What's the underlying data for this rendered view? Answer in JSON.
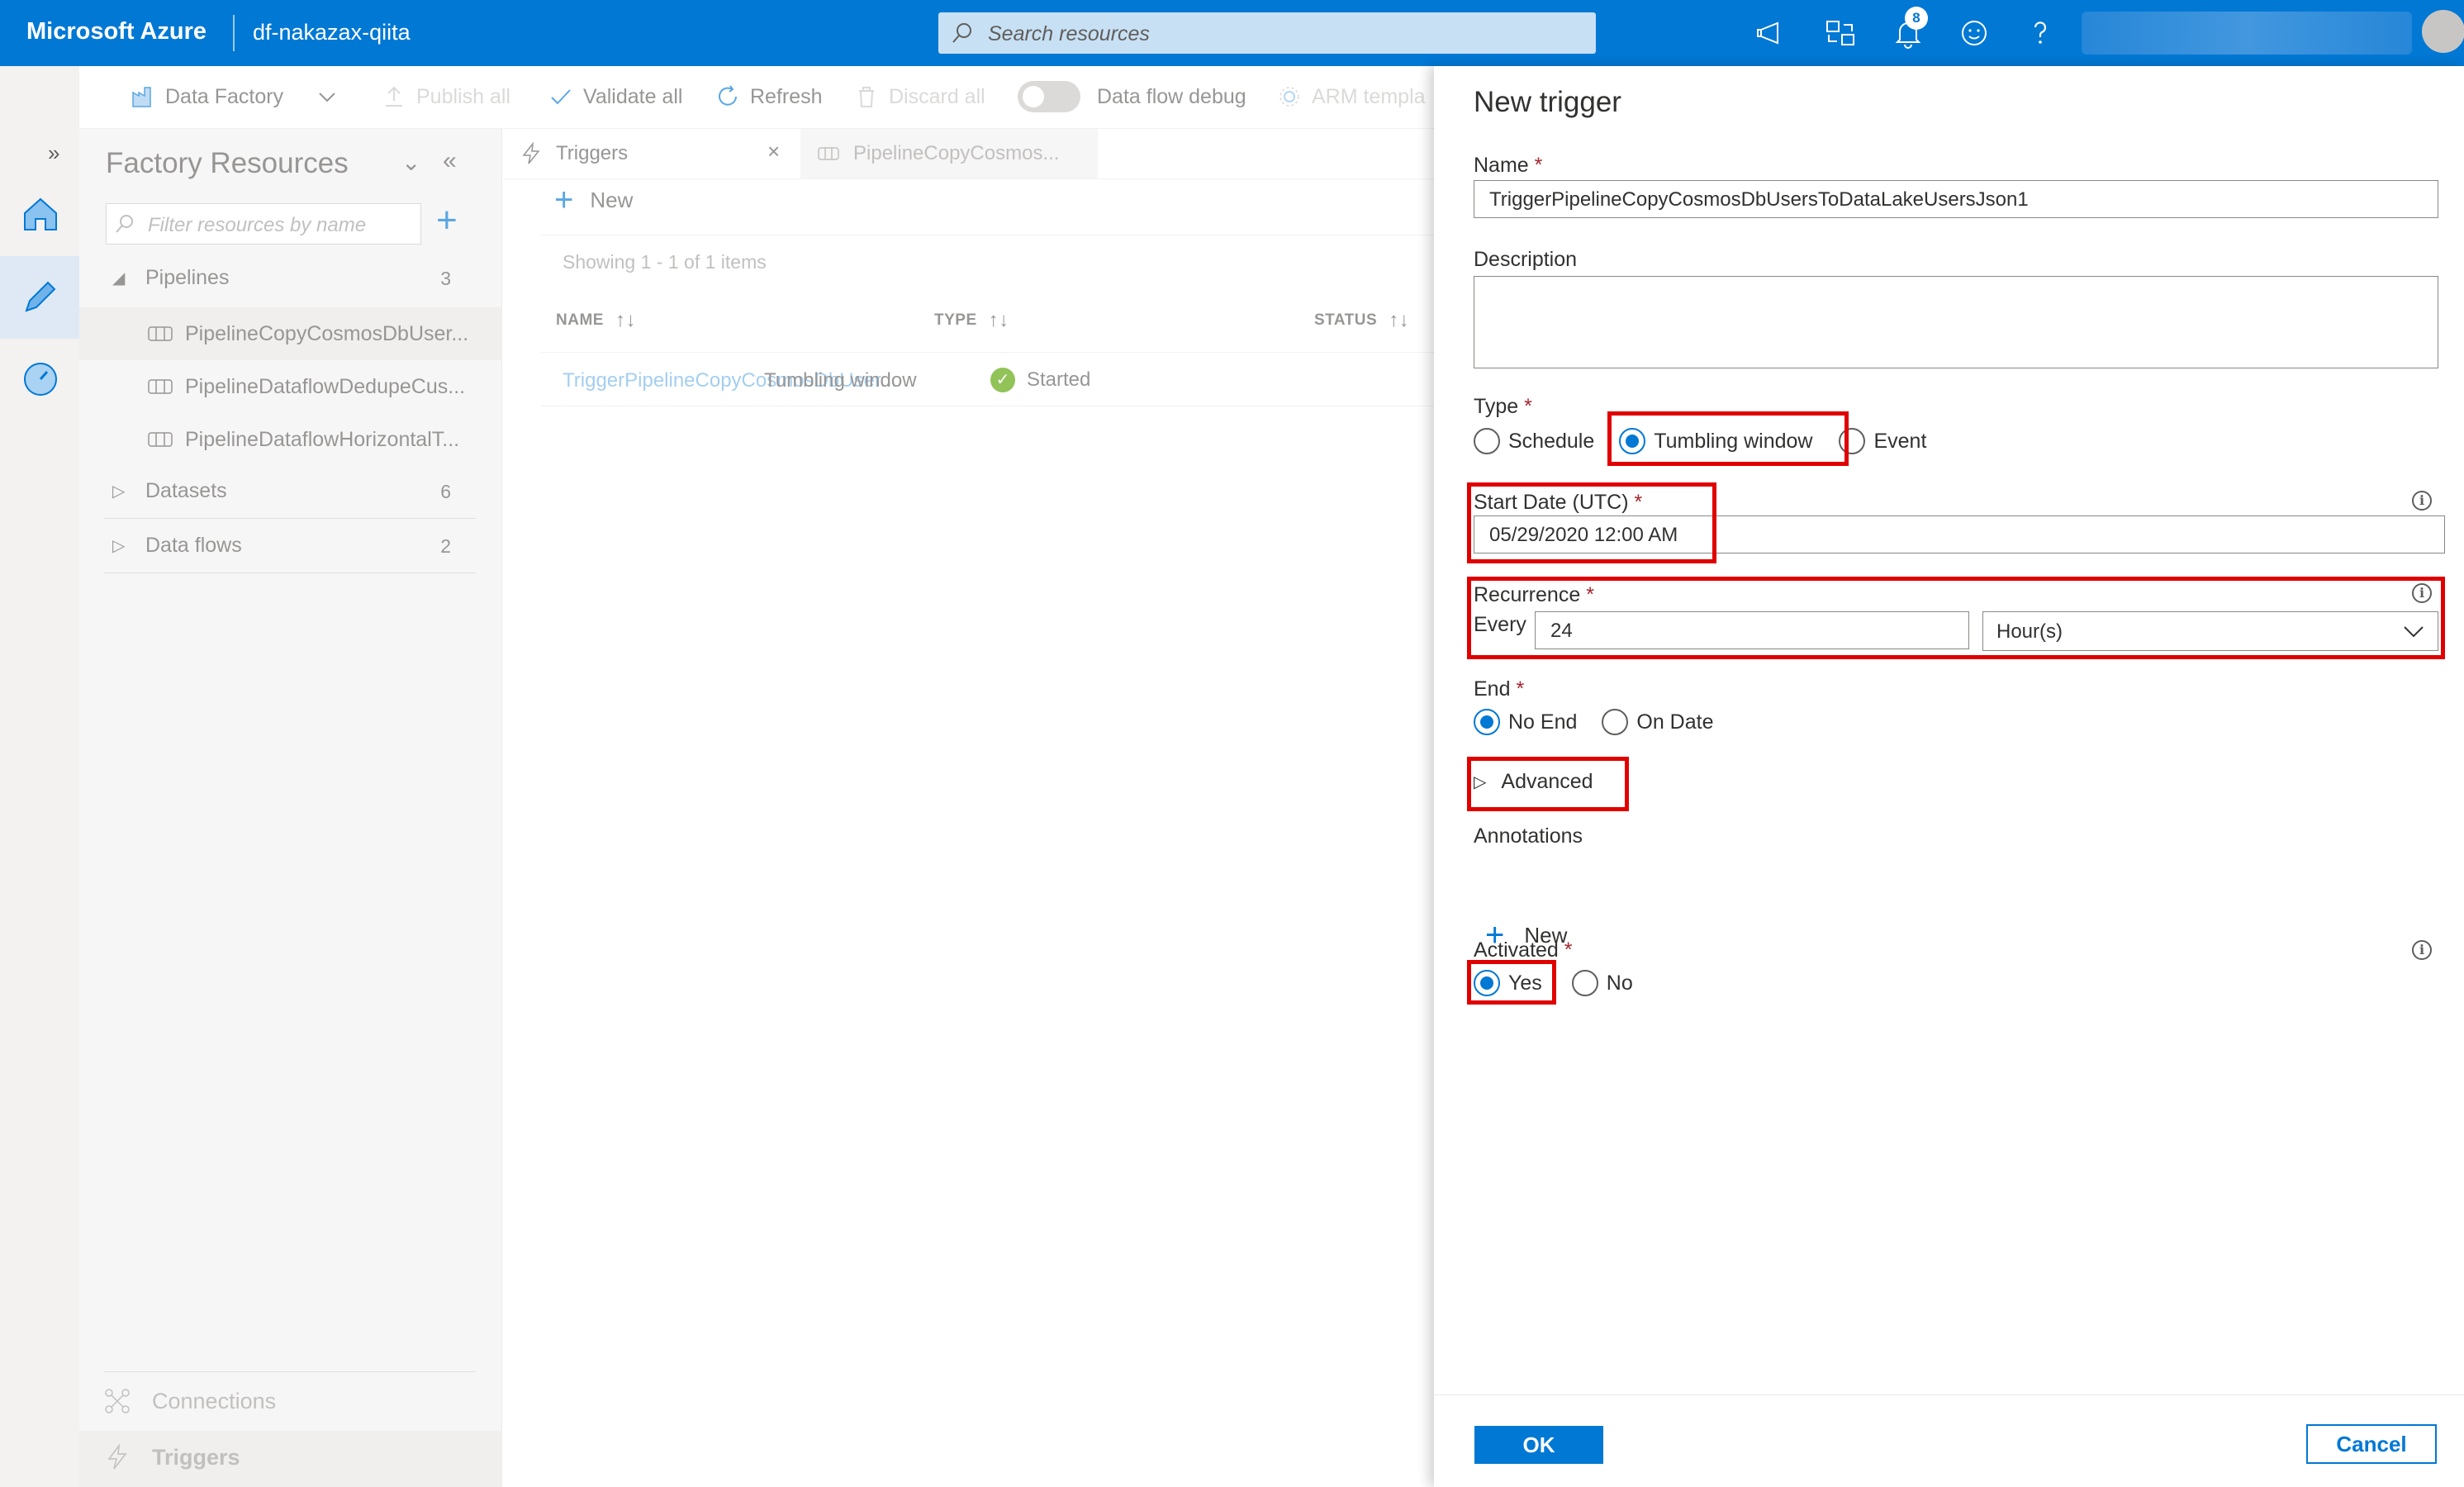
{
  "topbar": {
    "brand": "Microsoft Azure",
    "factory_name": "df-nakazax-qiita",
    "search_placeholder": "Search resources",
    "notification_count": "8"
  },
  "toolbar": {
    "data_factory": "Data Factory",
    "publish_all": "Publish all",
    "validate_all": "Validate all",
    "refresh": "Refresh",
    "discard_all": "Discard all",
    "data_flow_debug": "Data flow debug",
    "arm_template": "ARM templa"
  },
  "factory_resources": {
    "title": "Factory Resources",
    "filter_placeholder": "Filter resources by name",
    "sections": [
      {
        "label": "Pipelines",
        "count": "3"
      },
      {
        "label": "Datasets",
        "count": "6"
      },
      {
        "label": "Data flows",
        "count": "2"
      }
    ],
    "pipelines": [
      "PipelineCopyCosmosDbUser...",
      "PipelineDataflowDedupeCus...",
      "PipelineDataflowHorizontalT..."
    ],
    "connections": "Connections",
    "triggers": "Triggers"
  },
  "center": {
    "tabs": [
      {
        "label": "Triggers"
      },
      {
        "label": "PipelineCopyCosmos..."
      }
    ],
    "new_label": "New",
    "showing": "Showing 1 - 1 of 1 items",
    "columns": [
      "NAME",
      "TYPE",
      "STATUS"
    ],
    "rows": [
      {
        "name": "TriggerPipelineCopyCosmosDbUser...",
        "type": "Tumbling window",
        "status": "Started"
      }
    ]
  },
  "trigger_form": {
    "title": "New trigger",
    "name_label": "Name",
    "name_value": "TriggerPipelineCopyCosmosDbUsersToDataLakeUsersJson1",
    "description_label": "Description",
    "type_label": "Type",
    "type_options": [
      "Schedule",
      "Tumbling window",
      "Event"
    ],
    "type_selected": "Tumbling window",
    "start_date_label": "Start Date (UTC)",
    "start_date_value": "05/29/2020 12:00 AM",
    "recurrence_label": "Recurrence",
    "every_label": "Every",
    "every_value": "24",
    "unit_value": "Hour(s)",
    "end_label": "End",
    "end_options": [
      "No End",
      "On Date"
    ],
    "end_selected": "No End",
    "advanced_label": "Advanced",
    "annotations_label": "Annotations",
    "annotations_new": "New",
    "activated_label": "Activated",
    "activated_options": [
      "Yes",
      "No"
    ],
    "activated_selected": "Yes",
    "ok_label": "OK",
    "cancel_label": "Cancel"
  },
  "colors": {
    "azure_blue": "#0078d4",
    "highlight_red": "#e00000",
    "status_green": "#57a300"
  }
}
